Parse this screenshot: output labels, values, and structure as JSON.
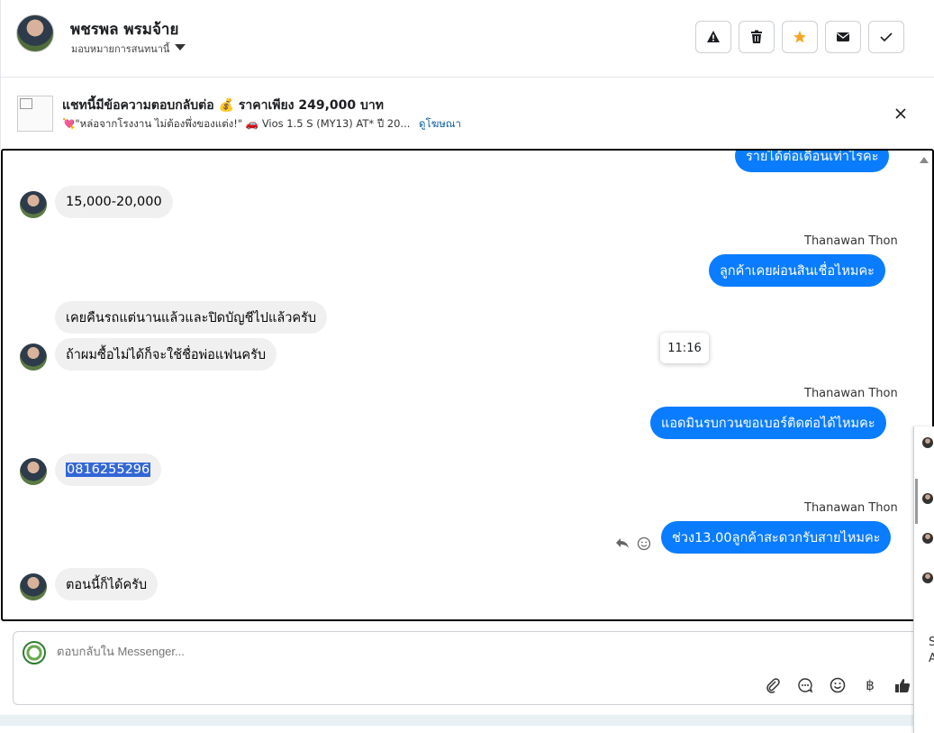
{
  "header": {
    "name": "พชรพล พรมจ้าย",
    "assign_label": "มอบหมายการสนทนานี้"
  },
  "actions": [
    {
      "name": "spam-icon"
    },
    {
      "name": "trash-icon"
    },
    {
      "name": "star-icon",
      "color": "#f5a623"
    },
    {
      "name": "mail-icon"
    },
    {
      "name": "check-icon"
    }
  ],
  "ad": {
    "title": "แชทนี้มีข้อความตอบกลับต่อ 💰 ราคาเพียง 249,000 บาท",
    "line": "💘\"หล่อจากโรงงาน ไม่ต้องพึ่งของแต่ง!\" 🚗 Vios 1.5 S (MY13) AT* ปี 20...",
    "link": "ดูโฆษณา"
  },
  "messages": [
    {
      "dir": "out",
      "text": "รายได้ต่อเดือนเท่าไรคะ"
    },
    {
      "dir": "in",
      "text": "15,000-20,000"
    },
    {
      "dir": "out",
      "sender": "Thanawan Thon",
      "text": "ลูกค้าเคยผ่อนสินเชื่อไหมคะ"
    },
    {
      "dir": "in",
      "text": "เคยคืนรถแต่นานแล้วและปิดบัญชีไปแล้วครับ"
    },
    {
      "dir": "in",
      "text": "ถ้าผมซื้อไม่ได้ก็จะใช้ชื่อพ่อแฟนครับ"
    },
    {
      "dir": "out",
      "sender": "Thanawan Thon",
      "text": "แอดมินรบกวนขอเบอร์ติดต่อได้ไหมคะ"
    },
    {
      "dir": "in",
      "text": "0816255296"
    },
    {
      "dir": "out",
      "sender": "Thanawan Thon",
      "text": "ช่วง13.00ลูกค้าสะดวกรับสายไหมคะ"
    },
    {
      "dir": "in",
      "text": "ตอนนี้ก็ได้ครับ"
    }
  ],
  "tooltip": "11:16",
  "composer": {
    "placeholder": "ตอบกลับใน Messenger..."
  },
  "tools": [
    {
      "name": "attach-icon"
    },
    {
      "name": "saved-reply-icon"
    },
    {
      "name": "emoji-icon"
    },
    {
      "name": "baht-icon",
      "glyph": "฿"
    },
    {
      "name": "thumbs-up-icon"
    }
  ],
  "side_panel": {
    "text1": "S",
    "text2": "A"
  }
}
